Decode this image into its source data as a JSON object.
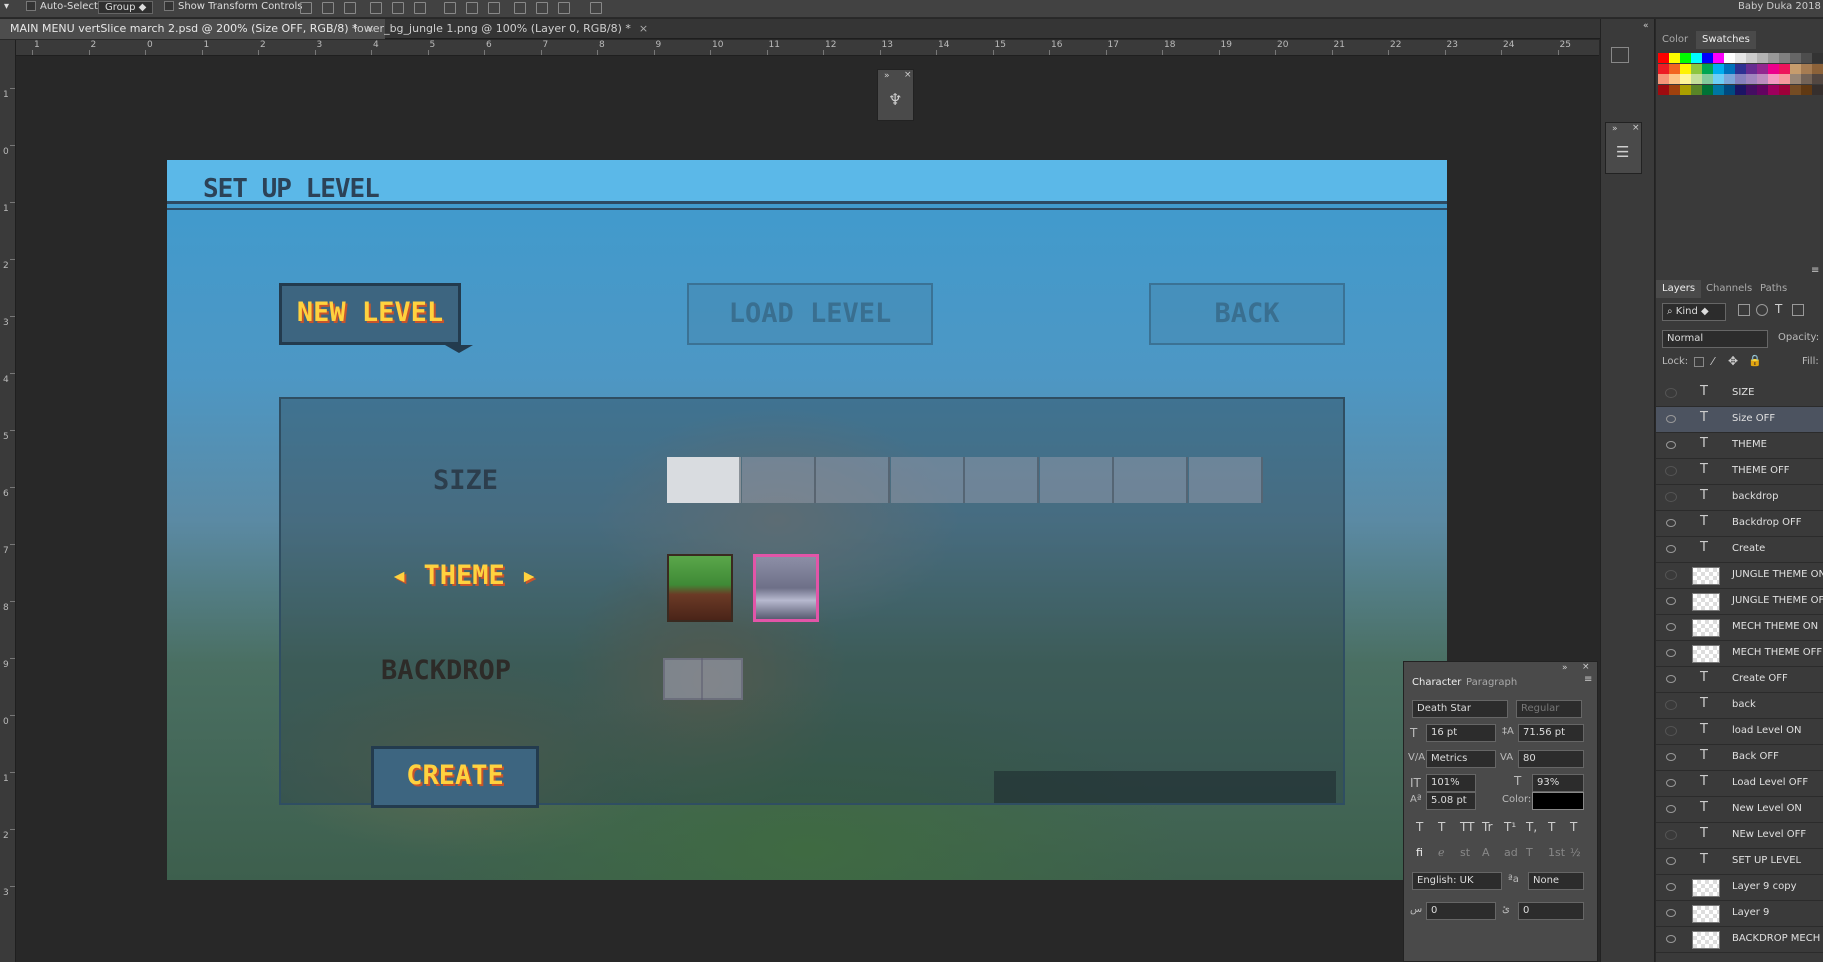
{
  "options_bar": {
    "auto_select_label": "Auto-Select:",
    "auto_select_value": "Group",
    "show_transform_label": "Show Transform Controls",
    "user": "Baby Duka 2018"
  },
  "doc_tabs": [
    {
      "label": "MAIN MENU vertSlice march 2.psd @ 200% (Size OFF, RGB/8) *",
      "close": "×"
    },
    {
      "label": "lower_bg_jungle 1.png @ 100% (Layer 0, RGB/8) *",
      "close": "×"
    }
  ],
  "ruler": {
    "h_labels": [
      "1",
      "2",
      "0",
      "1",
      "2",
      "3",
      "4",
      "5",
      "6",
      "7",
      "8",
      "9",
      "10",
      "11",
      "12",
      "13",
      "14",
      "15",
      "16",
      "17",
      "18",
      "19",
      "20",
      "21",
      "22",
      "23",
      "24",
      "25"
    ],
    "v_labels": [
      "1",
      "0",
      "1",
      "2",
      "3",
      "4",
      "5",
      "6",
      "7",
      "8",
      "9",
      "0",
      "1",
      "2",
      "3"
    ]
  },
  "game": {
    "title": "SET UP LEVEL",
    "new_level": "NEW LEVEL",
    "load_level": "LOAD LEVEL",
    "back": "BACK",
    "size_label": "SIZE",
    "theme_label": "◂ THEME ▸",
    "backdrop_label": "BACKDROP",
    "create": "CREATE",
    "size_segments": 8,
    "size_selected": 1
  },
  "swatch_panel": {
    "tabs": [
      "Color",
      "Swatches"
    ],
    "active": "Swatches",
    "colors": [
      "#ff0000",
      "#ffff00",
      "#00ff00",
      "#00ffff",
      "#0000ff",
      "#ff00ff",
      "#ffffff",
      "#e6e6e6",
      "#cccccc",
      "#b3b3b3",
      "#999999",
      "#808080",
      "#666666",
      "#4d4d4d",
      "#333333",
      "#ed1c24",
      "#f26522",
      "#fff200",
      "#8dc63f",
      "#00a651",
      "#00aeef",
      "#0072bc",
      "#2e3192",
      "#662d91",
      "#92278f",
      "#ec008c",
      "#ed145b",
      "#c69c6d",
      "#a67c52",
      "#8c6239",
      "#f69679",
      "#fdc689",
      "#fff799",
      "#c4df9b",
      "#82ca9c",
      "#6dcff6",
      "#7da7d9",
      "#8781bd",
      "#a186be",
      "#bd8cbf",
      "#f49ac1",
      "#f6989d",
      "#998675",
      "#736357",
      "#534741",
      "#9e0b0f",
      "#a0410d",
      "#aba000",
      "#598527",
      "#007236",
      "#0076a3",
      "#004a80",
      "#1b1464",
      "#440e62",
      "#630460",
      "#9e005d",
      "#9e0039",
      "#754c24",
      "#603913",
      "#362f2d"
    ]
  },
  "layers_panel": {
    "tabs": [
      "Layers",
      "Channels",
      "Paths"
    ],
    "active": "Layers",
    "filter": "Kind",
    "blend": "Normal",
    "opacity_label": "Opacity:",
    "lock_label": "Lock:",
    "fill_label": "Fill:",
    "layers": [
      {
        "name": "SIZE",
        "kind": "text",
        "visible": false,
        "selected": false
      },
      {
        "name": "Size OFF",
        "kind": "text",
        "visible": true,
        "selected": true
      },
      {
        "name": "THEME",
        "kind": "text",
        "visible": true,
        "selected": false
      },
      {
        "name": "THEME OFF",
        "kind": "text",
        "visible": false,
        "selected": false
      },
      {
        "name": "backdrop",
        "kind": "text",
        "visible": false,
        "selected": false
      },
      {
        "name": "Backdrop OFF",
        "kind": "text",
        "visible": true,
        "selected": false
      },
      {
        "name": "Create",
        "kind": "text",
        "visible": true,
        "selected": false
      },
      {
        "name": "JUNGLE THEME ON",
        "kind": "image",
        "visible": false,
        "selected": false
      },
      {
        "name": "JUNGLE THEME OFF",
        "kind": "image",
        "visible": true,
        "selected": false
      },
      {
        "name": "MECH THEME ON",
        "kind": "image",
        "visible": true,
        "selected": false
      },
      {
        "name": "MECH THEME OFF",
        "kind": "image",
        "visible": true,
        "selected": false
      },
      {
        "name": "Create OFF",
        "kind": "text",
        "visible": true,
        "selected": false
      },
      {
        "name": "back",
        "kind": "text",
        "visible": false,
        "selected": false
      },
      {
        "name": "load Level ON",
        "kind": "text",
        "visible": false,
        "selected": false
      },
      {
        "name": "Back OFF",
        "kind": "text",
        "visible": true,
        "selected": false
      },
      {
        "name": "Load Level OFF",
        "kind": "text",
        "visible": true,
        "selected": false
      },
      {
        "name": "New Level ON",
        "kind": "text",
        "visible": true,
        "selected": false
      },
      {
        "name": "NEw Level OFF",
        "kind": "text",
        "visible": false,
        "selected": false
      },
      {
        "name": "SET UP LEVEL",
        "kind": "text",
        "visible": true,
        "selected": false
      },
      {
        "name": "Layer 9 copy",
        "kind": "image",
        "visible": true,
        "selected": false
      },
      {
        "name": "Layer 9",
        "kind": "image",
        "visible": true,
        "selected": false
      },
      {
        "name": "BACKDROP MECH",
        "kind": "image",
        "visible": true,
        "selected": false
      }
    ]
  },
  "character_panel": {
    "tabs": [
      "Character",
      "Paragraph"
    ],
    "active": "Character",
    "font": "Death Star",
    "style": "Regular",
    "size": "16 pt",
    "leading": "71.56 pt",
    "kerning": "Metrics",
    "tracking": "80",
    "vscale": "101%",
    "hscale": "93%",
    "baseline": "5.08 pt",
    "color_label": "Color:",
    "color": "#000000",
    "language": "English: UK",
    "aa_label": "ªa",
    "aa": "None",
    "a1": "0",
    "a2": "0",
    "style_buttons": [
      "T",
      "T",
      "TT",
      "Tr",
      "T¹",
      "T,",
      "T",
      "T"
    ],
    "ot_buttons": [
      "fi",
      "ℯ",
      "st",
      "A",
      "ad",
      "T",
      "1st",
      "½"
    ]
  }
}
